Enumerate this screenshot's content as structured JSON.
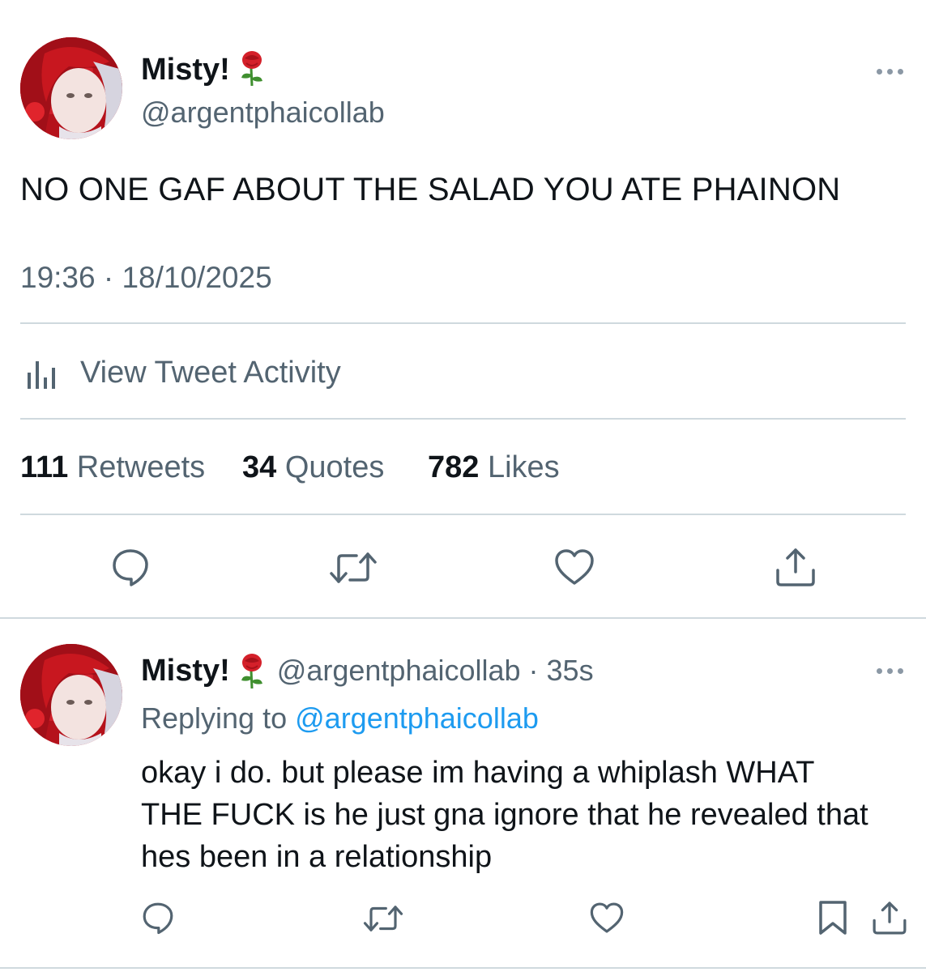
{
  "main_tweet": {
    "author": {
      "name": "Misty!",
      "emoji": "🌹",
      "handle": "@argentphaicollab"
    },
    "text": "NO ONE GAF ABOUT THE SALAD YOU ATE PHAINON",
    "timestamp": "19:36 · 18/10/2025",
    "activity_label": "View Tweet Activity",
    "stats": {
      "retweets_count": "111",
      "retweets_label": "Retweets",
      "quotes_count": "34",
      "quotes_label": "Quotes",
      "likes_count": "782",
      "likes_label": "Likes"
    },
    "actions": [
      "reply-icon",
      "retweet-icon",
      "like-icon",
      "share-icon"
    ]
  },
  "reply": {
    "author": {
      "name": "Misty!",
      "emoji": "🌹",
      "handle_time": "@argentphaicollab · 35s"
    },
    "replying_prefix": "Replying to",
    "replying_handle": "@argentphaicollab",
    "text_lines": [
      "okay i do. but please im having a whiplash WHAT",
      "THE FUCK is he just gna ignore that he revealed that",
      "hes been in a relationship"
    ],
    "actions": [
      "reply-icon",
      "retweet-icon",
      "like-icon",
      "bookmark-icon",
      "share-icon"
    ]
  },
  "colors": {
    "text_primary": "#0f1419",
    "text_secondary": "#536471",
    "link": "#1d9bf0",
    "divider": "#cfd9de",
    "rose_red": "#d4202a",
    "rose_stem": "#3f8f2f"
  }
}
